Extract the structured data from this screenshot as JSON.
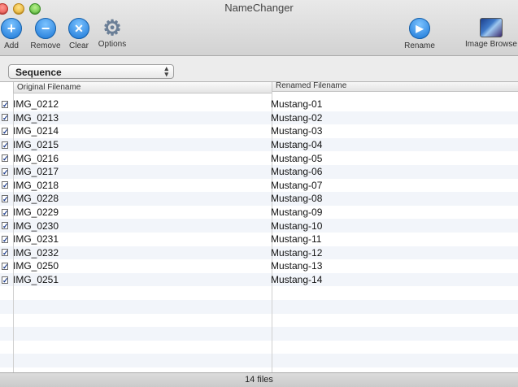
{
  "window": {
    "title": "NameChanger"
  },
  "toolbar": {
    "add_label": "Add",
    "remove_label": "Remove",
    "clear_label": "Clear",
    "options_label": "Options",
    "rename_label": "Rename",
    "image_browser_label": "Image Browse"
  },
  "mode_select": {
    "value": "Sequence"
  },
  "table": {
    "columns": [
      "Original Filename",
      "Renamed Filename"
    ],
    "rows": [
      {
        "original": "IMG_0212",
        "renamed": "Mustang-01",
        "checked": true
      },
      {
        "original": "IMG_0213",
        "renamed": "Mustang-02",
        "checked": true
      },
      {
        "original": "IMG_0214",
        "renamed": "Mustang-03",
        "checked": true
      },
      {
        "original": "IMG_0215",
        "renamed": "Mustang-04",
        "checked": true
      },
      {
        "original": "IMG_0216",
        "renamed": "Mustang-05",
        "checked": true
      },
      {
        "original": "IMG_0217",
        "renamed": "Mustang-06",
        "checked": true
      },
      {
        "original": "IMG_0218",
        "renamed": "Mustang-07",
        "checked": true
      },
      {
        "original": "IMG_0228",
        "renamed": "Mustang-08",
        "checked": true
      },
      {
        "original": "IMG_0229",
        "renamed": "Mustang-09",
        "checked": true
      },
      {
        "original": "IMG_0230",
        "renamed": "Mustang-10",
        "checked": true
      },
      {
        "original": "IMG_0231",
        "renamed": "Mustang-11",
        "checked": true
      },
      {
        "original": "IMG_0232",
        "renamed": "Mustang-12",
        "checked": true
      },
      {
        "original": "IMG_0250",
        "renamed": "Mustang-13",
        "checked": true
      },
      {
        "original": "IMG_0251",
        "renamed": "Mustang-14",
        "checked": true
      }
    ]
  },
  "status": {
    "text": "14 files"
  },
  "icons": {
    "add": "plus-circle-icon",
    "remove": "minus-circle-icon",
    "clear": "x-circle-icon",
    "options": "gear-icon",
    "rename": "play-circle-icon",
    "image_browser": "photo-icon"
  }
}
